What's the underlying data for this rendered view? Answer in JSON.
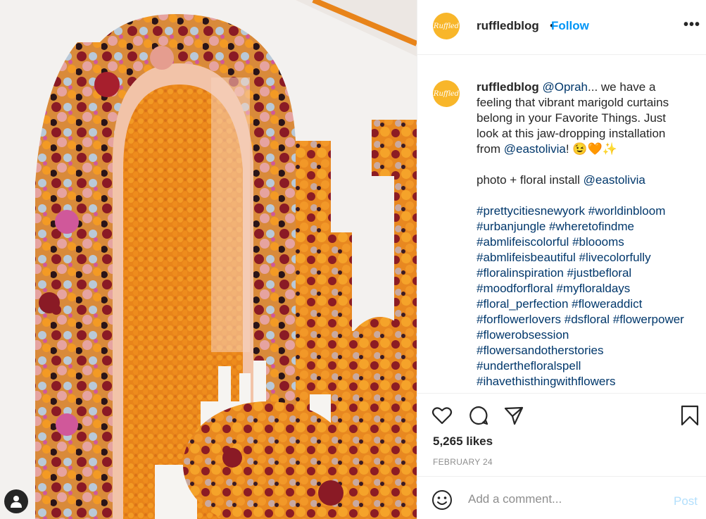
{
  "post": {
    "image_alt": "",
    "user_tag_icon": "user-tag-icon"
  },
  "header": {
    "avatar_text": "Ruffled",
    "username": "ruffledblog",
    "separator": "•",
    "follow_label": "Follow",
    "more_label": "•••"
  },
  "caption": {
    "username": "ruffledblog",
    "mention1": "@Oprah",
    "text1": "... we have a feeling that vibrant marigold curtains belong in your Favorite Things. Just look at this jaw-dropping installation from ",
    "mention2": "@eastolivia",
    "text2": "! 😉🧡✨",
    "credit_text": "photo + floral install ",
    "credit_mention": "@eastolivia",
    "hashtags": [
      "#prettycitiesnewyork",
      "#worldinbloom",
      "#urbanjungle",
      "#wheretofindme",
      "#abmlifeiscolorful",
      "#bloooms",
      "#abmlifeisbeautiful",
      "#livecolorfully",
      "#floralinspiration",
      "#justbefloral",
      "#moodforfloral",
      "#myfloraldays",
      "#floral_perfection",
      "#floweraddict",
      "#forflowerlovers",
      "#dsfloral",
      "#flowerpower",
      "#flowerobsession",
      "#flowersandotherstories",
      "#underthefloralspell",
      "#ihavethisthingwithflowers"
    ]
  },
  "actions": {
    "like_icon": "heart-icon",
    "comment_icon": "comment-icon",
    "share_icon": "share-icon",
    "save_icon": "bookmark-icon",
    "likes": "5,265 likes",
    "date": "FEBRUARY 24"
  },
  "comment_box": {
    "placeholder": "Add a comment...",
    "post_label": "Post"
  },
  "colors": {
    "accent": "#0095f6",
    "link": "#00376b",
    "marigold": "#f08a1c",
    "avatar": "#f8b62a"
  }
}
